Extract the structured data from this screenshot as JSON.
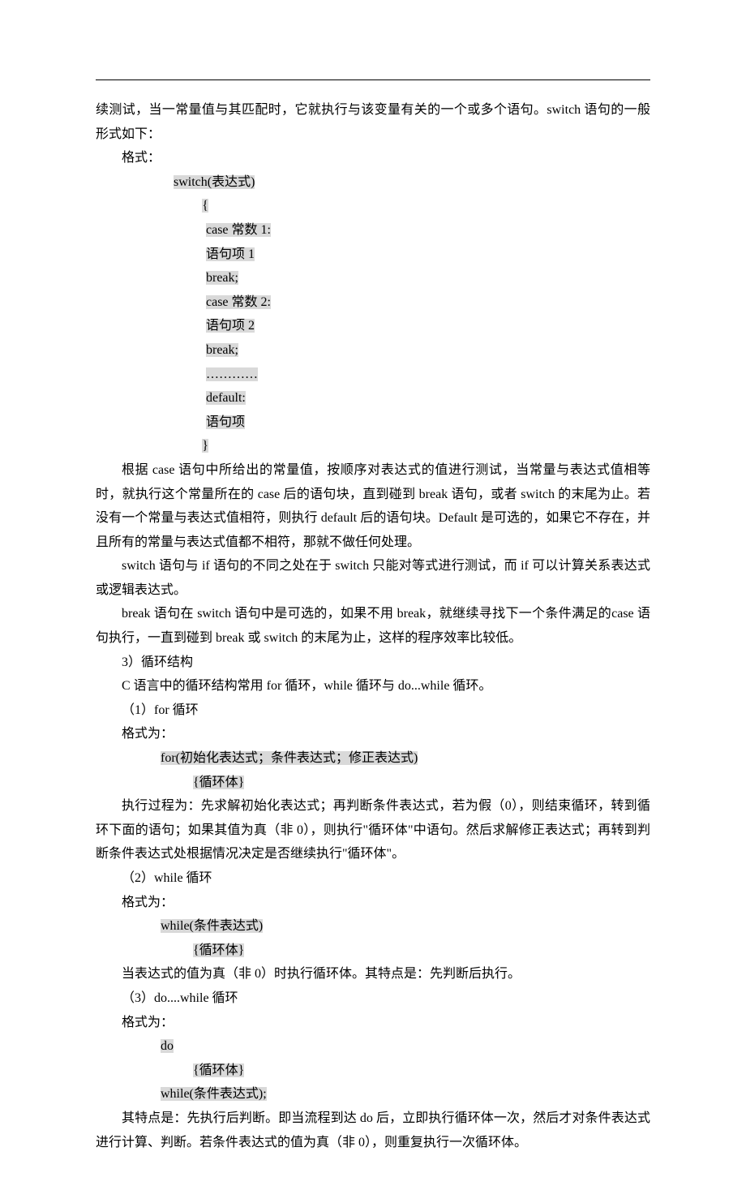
{
  "para1": "续测试，当一常量值与其匹配时，它就执行与该变量有关的一个或多个语句。switch 语句的一般形式如下：",
  "para2": "格式：",
  "switch": {
    "l1": "switch(表达式)",
    "l2": "{",
    "l3": "case  常数 1:",
    "l4": "语句项 1",
    "l5": "break;",
    "l6": "case 常数 2:",
    "l7": "语句项 2",
    "l8": "break;",
    "l9": "…………",
    "l10": "default:",
    "l11": "语句项",
    "l12": "}"
  },
  "para3": "根据 case 语句中所给出的常量值，按顺序对表达式的值进行测试，当常量与表达式值相等时，就执行这个常量所在的 case 后的语句块，直到碰到 break 语句，或者 switch 的末尾为止。若没有一个常量与表达式值相符，则执行 default 后的语句块。Default 是可选的，如果它不存在，并且所有的常量与表达式值都不相符，那就不做任何处理。",
  "para4": "switch 语句与 if 语句的不同之处在于 switch 只能对等式进行测试，而 if 可以计算关系表达式或逻辑表达式。",
  "para5": "break 语句在 switch 语句中是可选的，如果不用 break，就继续寻找下一个条件满足的case 语句执行，一直到碰到 break 或 switch 的末尾为止，这样的程序效率比较低。",
  "para6": "3）循环结构",
  "para7": "C 语言中的循环结构常用 for 循环，while 循环与 do...while 循环。",
  "para8": "（1）for 循环",
  "para9": "格式为：",
  "for": {
    "l1": "for(初始化表达式；条件表达式；修正表达式)",
    "l2": "{循环体}"
  },
  "para10": "执行过程为：先求解初始化表达式；再判断条件表达式，若为假（0），则结束循环，转到循环下面的语句；如果其值为真（非 0），则执行\"循环体\"中语句。然后求解修正表达式；再转到判断条件表达式处根据情况决定是否继续执行\"循环体\"。",
  "para11": "（2）while 循环",
  "para12": "格式为：",
  "while": {
    "l1": "while(条件表达式)",
    "l2": "{循环体}"
  },
  "para13": "当表达式的值为真（非 0）时执行循环体。其特点是：先判断后执行。",
  "para14": "（3）do....while 循环",
  "para15": "格式为：",
  "dowhile": {
    "l1": "do",
    "l2": "{循环体}",
    "l3": "while(条件表达式);"
  },
  "para16": "其特点是：先执行后判断。即当流程到达 do 后，立即执行循环体一次，然后才对条件表达式进行计算、判断。若条件表达式的值为真（非 0），则重复执行一次循环体。"
}
